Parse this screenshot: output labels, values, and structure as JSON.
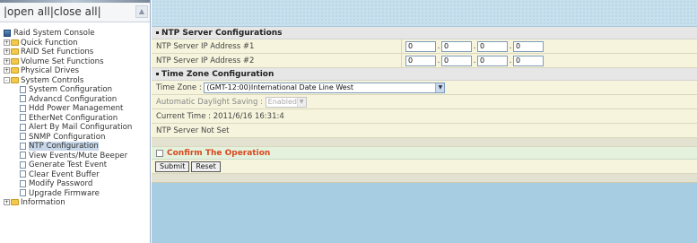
{
  "left": {
    "open_all": "open all",
    "sep": "|",
    "close_all": "close all",
    "tree": [
      {
        "label": "Raid System Console",
        "icon": "raid-icon",
        "level": 0,
        "expander": ""
      },
      {
        "label": "Quick Function",
        "icon": "folder-icon",
        "level": 0,
        "expander": "+"
      },
      {
        "label": "RAID Set Functions",
        "icon": "folder-icon",
        "level": 0,
        "expander": "+"
      },
      {
        "label": "Volume Set Functions",
        "icon": "folder-icon",
        "level": 0,
        "expander": "+"
      },
      {
        "label": "Physical Drives",
        "icon": "folder-icon",
        "level": 0,
        "expander": "+"
      },
      {
        "label": "System Controls",
        "icon": "folder-icon",
        "level": 0,
        "expander": "-"
      },
      {
        "label": "System Configuration",
        "icon": "doc-icon",
        "level": 1
      },
      {
        "label": "Advancd Configuration",
        "icon": "doc-icon",
        "level": 1
      },
      {
        "label": "Hdd Power Management",
        "icon": "doc-icon",
        "level": 1
      },
      {
        "label": "EtherNet Configuration",
        "icon": "doc-icon",
        "level": 1
      },
      {
        "label": "Alert By Mail Configuration",
        "icon": "doc-icon",
        "level": 1
      },
      {
        "label": "SNMP Configuration",
        "icon": "doc-icon",
        "level": 1
      },
      {
        "label": "NTP Configuration",
        "icon": "doc-icon",
        "level": 1,
        "selected": true
      },
      {
        "label": "View Events/Mute Beeper",
        "icon": "doc-icon",
        "level": 1
      },
      {
        "label": "Generate Test Event",
        "icon": "doc-icon",
        "level": 1
      },
      {
        "label": "Clear Event Buffer",
        "icon": "doc-icon",
        "level": 1
      },
      {
        "label": "Modify Password",
        "icon": "doc-icon",
        "level": 1
      },
      {
        "label": "Upgrade Firmware",
        "icon": "doc-icon",
        "level": 1
      },
      {
        "label": "Information",
        "icon": "folder-icon",
        "level": 0,
        "expander": "+"
      }
    ]
  },
  "ntp": {
    "section_title": "NTP Server Configurations",
    "server1_label": "NTP Server IP Address #1",
    "server1": [
      "0",
      "0",
      "0",
      "0"
    ],
    "server2_label": "NTP Server IP Address #2",
    "server2": [
      "0",
      "0",
      "0",
      "0"
    ]
  },
  "tz": {
    "section_title": "Time Zone Configuration",
    "zone_label": "Time Zone :",
    "zone_value": "(GMT-12:00)International Date Line West",
    "dst_label": "Automatic Daylight Saving :",
    "dst_value": "Enabled",
    "current_time": "Current Time : 2011/6/16 16:31:4",
    "ntp_status": "NTP Server Not Set"
  },
  "confirm": {
    "label": "Confirm The Operation"
  },
  "buttons": {
    "submit": "Submit",
    "reset": "Reset"
  },
  "ip_separator": "."
}
